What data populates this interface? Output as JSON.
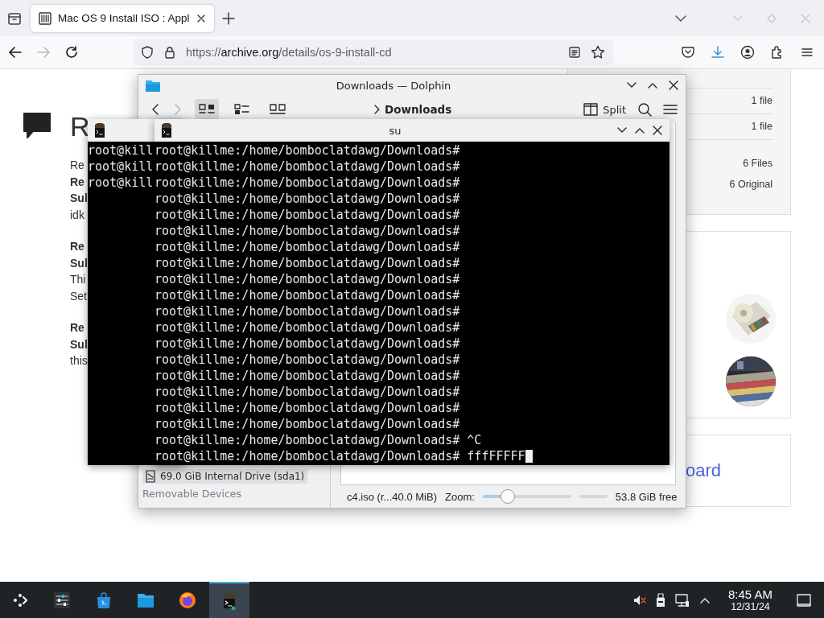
{
  "browser": {
    "tabs": [
      {
        "title": "Mac OS 9 Install ISO : Appl",
        "selected": true
      }
    ],
    "url": {
      "scheme": "https://",
      "host": "archive.org",
      "path": "/details/os-9-install-cd"
    },
    "page": {
      "heading": "R",
      "reviews": [
        {
          "lines": [
            {
              "text": "Re",
              "kind": "plain"
            },
            {
              "text": "Re",
              "kind": "bold"
            },
            {
              "text": "Sul",
              "kind": "bold"
            },
            {
              "text": "idk",
              "kind": "plain"
            }
          ]
        },
        {
          "lines": [
            {
              "text": "Re",
              "kind": "bold"
            },
            {
              "text": "Sul",
              "kind": "bold"
            },
            {
              "text": "Thi",
              "kind": "plain"
            },
            {
              "text": "Set",
              "kind": "plain"
            }
          ]
        },
        {
          "lines": [
            {
              "text": "Re",
              "kind": "bold"
            },
            {
              "text": "Sul",
              "kind": "bold"
            },
            {
              "text": "this",
              "kind": "plain"
            }
          ]
        }
      ],
      "file_counts": [
        "1 file",
        "1 file"
      ],
      "totals": [
        "6 Files",
        "6 Original"
      ],
      "related": [
        {
          "kind": "picture"
        },
        {
          "kind": "picture"
        }
      ],
      "link": "oard"
    }
  },
  "dolphin": {
    "title": "Downloads — Dolphin",
    "breadcrumb": "Downloads",
    "split": "Split",
    "places": [
      {
        "label": "69.0 GiB Internal Drive (sda1)",
        "kind": "drive"
      },
      {
        "label": "Removable Devices",
        "kind": "header"
      }
    ],
    "status": "c4.iso (r...40.0 MiB)",
    "zoom_label": "Zoom:",
    "zoom": {
      "level": 0.28
    },
    "free": "53.8 GiB free"
  },
  "terminals": [
    {
      "lines": [
        "root@kill",
        "root@kill",
        "root@kill"
      ]
    },
    {
      "title": "su",
      "lines": [
        "root@killme:/home/bomboclatdawg/Downloads#",
        "root@killme:/home/bomboclatdawg/Downloads#",
        "root@killme:/home/bomboclatdawg/Downloads#",
        "root@killme:/home/bomboclatdawg/Downloads#",
        "root@killme:/home/bomboclatdawg/Downloads#",
        "root@killme:/home/bomboclatdawg/Downloads#",
        "root@killme:/home/bomboclatdawg/Downloads#",
        "root@killme:/home/bomboclatdawg/Downloads#",
        "root@killme:/home/bomboclatdawg/Downloads#",
        "root@killme:/home/bomboclatdawg/Downloads#",
        "root@killme:/home/bomboclatdawg/Downloads#",
        "root@killme:/home/bomboclatdawg/Downloads#",
        "root@killme:/home/bomboclatdawg/Downloads#",
        "root@killme:/home/bomboclatdawg/Downloads#",
        "root@killme:/home/bomboclatdawg/Downloads#",
        "root@killme:/home/bomboclatdawg/Downloads#",
        "root@killme:/home/bomboclatdawg/Downloads#",
        "root@killme:/home/bomboclatdawg/Downloads#",
        "root@killme:/home/bomboclatdawg/Downloads# ^C"
      ],
      "input": "root@killme:/home/bomboclatdawg/Downloads# fffFFFFF"
    }
  ],
  "taskbar": {
    "apps": [
      {
        "kind": "launcher",
        "active": false
      },
      {
        "kind": "settings",
        "active": false
      },
      {
        "kind": "discover",
        "active": false
      },
      {
        "kind": "files",
        "active": false
      },
      {
        "kind": "firefox",
        "active": false
      },
      {
        "kind": "terminal",
        "active": true
      }
    ],
    "clock": {
      "time": "8:45 AM",
      "date": "12/31/24"
    }
  }
}
